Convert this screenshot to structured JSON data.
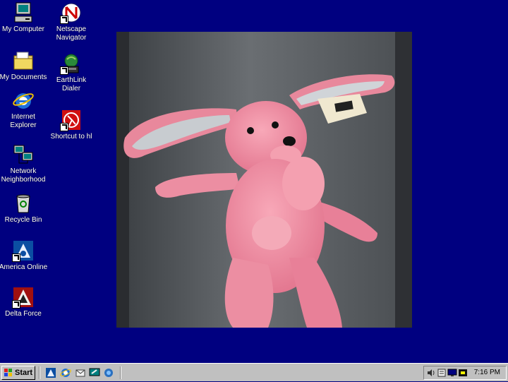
{
  "desktop": {
    "background": "#000080",
    "icons": [
      {
        "name": "my-computer",
        "label": "My Computer",
        "icon": "computer-icon"
      },
      {
        "name": "netscape-navigator",
        "label": "Netscape Navigator",
        "icon": "netscape-icon"
      },
      {
        "name": "my-documents",
        "label": "My Documents",
        "icon": "folder-icon"
      },
      {
        "name": "earthlink-dialer",
        "label": "EarthLink Dialer",
        "icon": "earthlink-icon"
      },
      {
        "name": "internet-explorer",
        "label": "Internet Explorer",
        "icon": "ie-icon"
      },
      {
        "name": "shortcut-to-hl",
        "label": "Shortcut to hl",
        "icon": "halflife-icon"
      },
      {
        "name": "network-neighborhood",
        "label": "Network Neighborhood",
        "icon": "network-icon"
      },
      {
        "name": "recycle-bin",
        "label": "Recycle Bin",
        "icon": "recycle-bin-icon"
      },
      {
        "name": "america-online",
        "label": "America Online",
        "icon": "aol-icon"
      },
      {
        "name": "delta-force",
        "label": "Delta Force",
        "icon": "delta-force-icon"
      }
    ],
    "wallpaper": {
      "subject": "pink-bunny-plush",
      "accent": "#f0899e"
    }
  },
  "taskbar": {
    "start_label": "Start",
    "quick_launch": [
      "aol-icon",
      "ie-icon",
      "outlook-icon",
      "desktop-icon",
      "channels-icon"
    ],
    "tray_icons": [
      "speaker-icon",
      "scheduler-icon",
      "monitor-icon",
      "display-icon"
    ],
    "clock": "7:16 PM"
  }
}
